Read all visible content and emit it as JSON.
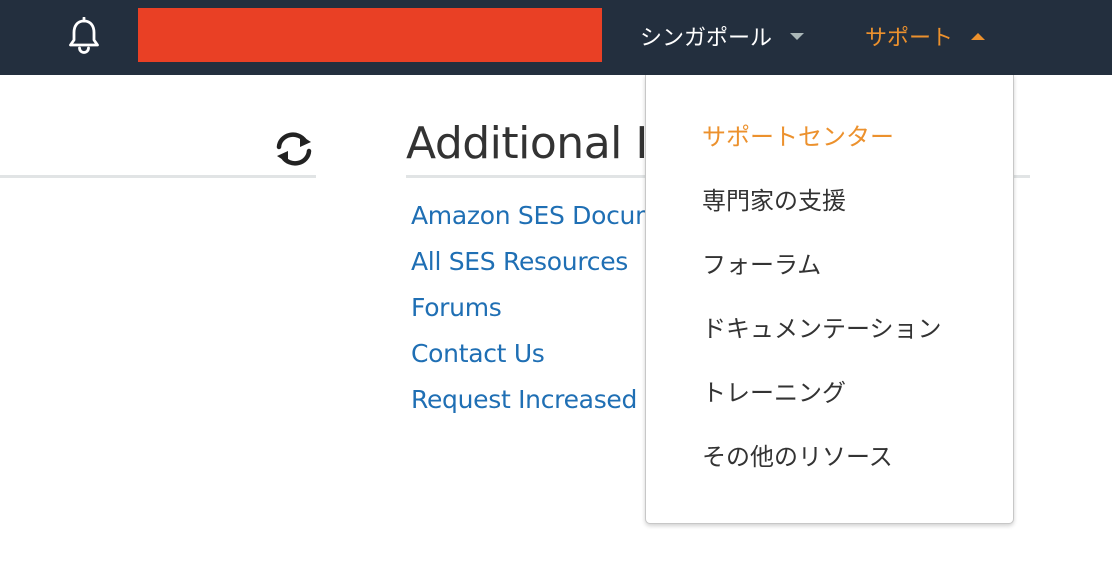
{
  "topbar": {
    "region_label": "シンガポール",
    "support_label": "サポート"
  },
  "panel": {
    "title": "Additional Information",
    "links": [
      "Amazon SES Documentation",
      "All SES Resources",
      "Forums",
      "Contact Us",
      "Request Increased Sending Limits"
    ]
  },
  "support_dropdown": {
    "items": [
      "サポートセンター",
      "専門家の支援",
      "フォーラム",
      "ドキュメンテーション",
      "トレーニング",
      "その他のリソース"
    ]
  },
  "colors": {
    "topbar_bg": "#232f3e",
    "accent_orange": "#ec912d",
    "link_blue": "#1f6fb4",
    "redaction": "#e94025"
  },
  "icons": {
    "notifications": "bell-icon",
    "refresh": "refresh-icon"
  }
}
